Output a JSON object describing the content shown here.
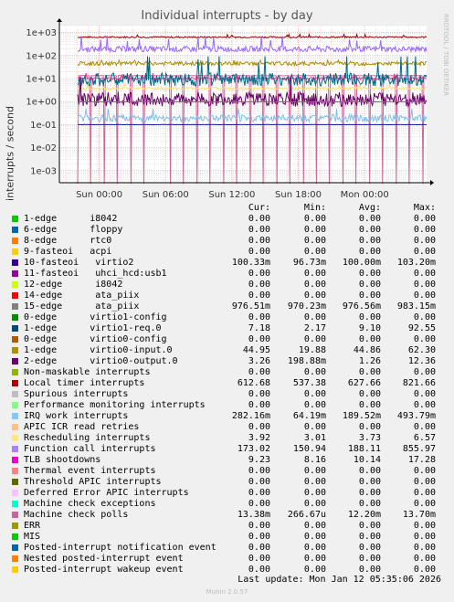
{
  "chart_data": {
    "type": "line",
    "title": "Individual interrupts - by day",
    "ylabel": "interrupts / second",
    "side_credit": "RRDTOOL / TOBI OETIKER",
    "y_scale": "log",
    "ylim": [
      0.0003,
      2000
    ],
    "y_ticks": [
      "1e+03",
      "1e+02",
      "1e+01",
      "1e+00",
      "1e-01",
      "1e-02",
      "1e-03"
    ],
    "y_tick_values": [
      1000,
      100,
      10,
      1,
      0.1,
      0.01,
      0.001
    ],
    "x_ticks": [
      "Sun 00:00",
      "Sun 06:00",
      "Sun 12:00",
      "Sun 18:00",
      "Mon 00:00"
    ],
    "x_tick_hours": [
      0,
      6,
      12,
      18,
      24
    ],
    "x_range_hours": [
      -3.6,
      29.6
    ],
    "grid": true,
    "series": [
      {
        "name": "Local timer interrupts",
        "color": "#990000",
        "avg": 627.66,
        "min": 537.38,
        "max": 821.66
      },
      {
        "name": "Function call interrupts",
        "color": "#9966ff",
        "avg": 188.11,
        "min": 150.94,
        "max": 855.97
      },
      {
        "name": "Machine check polls",
        "color": "#cc6699",
        "avg": 12.2,
        "min": 0.000266,
        "max": 13.7
      },
      {
        "name": "1-edge virtio0-input.0",
        "color": "#b08c00",
        "avg": 44.86,
        "min": 19.88,
        "max": 62.3
      },
      {
        "name": "TLB shootdowns",
        "color": "#ff3399",
        "avg": 10.14,
        "min": 8.16,
        "max": 17.28
      },
      {
        "name": "1-edge virtio1-req.0",
        "color": "#006a88",
        "avg": 9.1,
        "min": 2.17,
        "max": 92.55
      },
      {
        "name": "Rescheduling interrupts",
        "color": "#ffe066",
        "avg": 3.73,
        "min": 3.01,
        "max": 6.57
      },
      {
        "name": "2-edge virtio0-output.0",
        "color": "#660066",
        "avg": 1.26,
        "min": 0.19888,
        "max": 12.36
      },
      {
        "name": "15-edge ata_piix",
        "color": "#3a9f30",
        "avg": 0.97656,
        "min": 0.97023,
        "max": 0.98315
      },
      {
        "name": "IRQ work interrupts",
        "color": "#7ec0ee",
        "avg": 0.18952,
        "min": 0.06419,
        "max": 0.49379
      },
      {
        "name": "10-fasteoi virtio2",
        "color": "#1a1aa8",
        "avg": 0.1,
        "min": 0.09673,
        "max": 0.1032
      }
    ]
  },
  "legend": {
    "headers": {
      "cur": "Cur:",
      "min": "Min:",
      "avg": "Avg:",
      "max": "Max:"
    },
    "rows": [
      {
        "label": "1-edge      i8042",
        "color": "#00cc00",
        "cur": "0.00",
        "min": "0.00",
        "avg": "0.00",
        "max": "0.00"
      },
      {
        "label": "6-edge      floppy",
        "color": "#0066b3",
        "cur": "0.00",
        "min": "0.00",
        "avg": "0.00",
        "max": "0.00"
      },
      {
        "label": "8-edge      rtc0",
        "color": "#ff8000",
        "cur": "0.00",
        "min": "0.00",
        "avg": "0.00",
        "max": "0.00"
      },
      {
        "label": "9-fasteoi   acpi",
        "color": "#ffcc00",
        "cur": "0.00",
        "min": "0.00",
        "avg": "0.00",
        "max": "0.00"
      },
      {
        "label": "10-fasteoi   virtio2",
        "color": "#330099",
        "cur": "100.33m",
        "min": "96.73m",
        "avg": "100.00m",
        "max": "103.20m"
      },
      {
        "label": "11-fasteoi   uhci_hcd:usb1",
        "color": "#990099",
        "cur": "0.00",
        "min": "0.00",
        "avg": "0.00",
        "max": "0.00"
      },
      {
        "label": "12-edge      i8042",
        "color": "#ccff00",
        "cur": "0.00",
        "min": "0.00",
        "avg": "0.00",
        "max": "0.00"
      },
      {
        "label": "14-edge      ata_piix",
        "color": "#ff0000",
        "cur": "0.00",
        "min": "0.00",
        "avg": "0.00",
        "max": "0.00"
      },
      {
        "label": "15-edge      ata_piix",
        "color": "#808080",
        "cur": "976.51m",
        "min": "970.23m",
        "avg": "976.56m",
        "max": "983.15m"
      },
      {
        "label": "0-edge      virtio1-config",
        "color": "#008f00",
        "cur": "0.00",
        "min": "0.00",
        "avg": "0.00",
        "max": "0.00"
      },
      {
        "label": "1-edge      virtio1-req.0",
        "color": "#00487d",
        "cur": "7.18",
        "min": "2.17",
        "avg": "9.10",
        "max": "92.55"
      },
      {
        "label": "0-edge      virtio0-config",
        "color": "#b35a00",
        "cur": "0.00",
        "min": "0.00",
        "avg": "0.00",
        "max": "0.00"
      },
      {
        "label": "1-edge      virtio0-input.0",
        "color": "#b38f00",
        "cur": "44.95",
        "min": "19.88",
        "avg": "44.86",
        "max": "62.30"
      },
      {
        "label": "2-edge      virtio0-output.0",
        "color": "#6b006b",
        "cur": "3.26",
        "min": "198.88m",
        "avg": "1.26",
        "max": "12.36"
      },
      {
        "label": "Non-maskable interrupts",
        "color": "#8fb300",
        "cur": "0.00",
        "min": "0.00",
        "avg": "0.00",
        "max": "0.00"
      },
      {
        "label": "Local timer interrupts",
        "color": "#b30000",
        "cur": "612.68",
        "min": "537.38",
        "avg": "627.66",
        "max": "821.66"
      },
      {
        "label": "Spurious interrupts",
        "color": "#bebebe",
        "cur": "0.00",
        "min": "0.00",
        "avg": "0.00",
        "max": "0.00"
      },
      {
        "label": "Performance monitoring interrupts",
        "color": "#80ff80",
        "cur": "0.00",
        "min": "0.00",
        "avg": "0.00",
        "max": "0.00"
      },
      {
        "label": "IRQ work interrupts",
        "color": "#80c9ff",
        "cur": "282.16m",
        "min": "64.19m",
        "avg": "189.52m",
        "max": "493.79m"
      },
      {
        "label": "APIC ICR read retries",
        "color": "#ffc080",
        "cur": "0.00",
        "min": "0.00",
        "avg": "0.00",
        "max": "0.00"
      },
      {
        "label": "Rescheduling interrupts",
        "color": "#ffe680",
        "cur": "3.92",
        "min": "3.01",
        "avg": "3.73",
        "max": "6.57"
      },
      {
        "label": "Function call interrupts",
        "color": "#aa80ff",
        "cur": "173.02",
        "min": "150.94",
        "avg": "188.11",
        "max": "855.97"
      },
      {
        "label": "TLB shootdowns",
        "color": "#ee00cc",
        "cur": "9.23",
        "min": "8.16",
        "avg": "10.14",
        "max": "17.28"
      },
      {
        "label": "Thermal event interrupts",
        "color": "#ff8080",
        "cur": "0.00",
        "min": "0.00",
        "avg": "0.00",
        "max": "0.00"
      },
      {
        "label": "Threshold APIC interrupts",
        "color": "#666600",
        "cur": "0.00",
        "min": "0.00",
        "avg": "0.00",
        "max": "0.00"
      },
      {
        "label": "Deferred Error APIC interrupts",
        "color": "#ffbfff",
        "cur": "0.00",
        "min": "0.00",
        "avg": "0.00",
        "max": "0.00"
      },
      {
        "label": "Machine check exceptions",
        "color": "#00ffcc",
        "cur": "0.00",
        "min": "0.00",
        "avg": "0.00",
        "max": "0.00"
      },
      {
        "label": "Machine check polls",
        "color": "#cc6699",
        "cur": "13.38m",
        "min": "266.67u",
        "avg": "12.20m",
        "max": "13.70m"
      },
      {
        "label": "ERR",
        "color": "#999900",
        "cur": "0.00",
        "min": "0.00",
        "avg": "0.00",
        "max": "0.00"
      },
      {
        "label": "MIS",
        "color": "#00cc00",
        "cur": "0.00",
        "min": "0.00",
        "avg": "0.00",
        "max": "0.00"
      },
      {
        "label": "Posted-interrupt notification event",
        "color": "#0066b3",
        "cur": "0.00",
        "min": "0.00",
        "avg": "0.00",
        "max": "0.00"
      },
      {
        "label": "Nested posted-interrupt event",
        "color": "#ff8000",
        "cur": "0.00",
        "min": "0.00",
        "avg": "0.00",
        "max": "0.00"
      },
      {
        "label": "Posted-interrupt wakeup event",
        "color": "#ffcc00",
        "cur": "0.00",
        "min": "0.00",
        "avg": "0.00",
        "max": "0.00"
      }
    ]
  },
  "footer": {
    "last_update": "Last update: Mon Jan 12 05:35:06 2026",
    "version": "Munin 2.0.57"
  }
}
